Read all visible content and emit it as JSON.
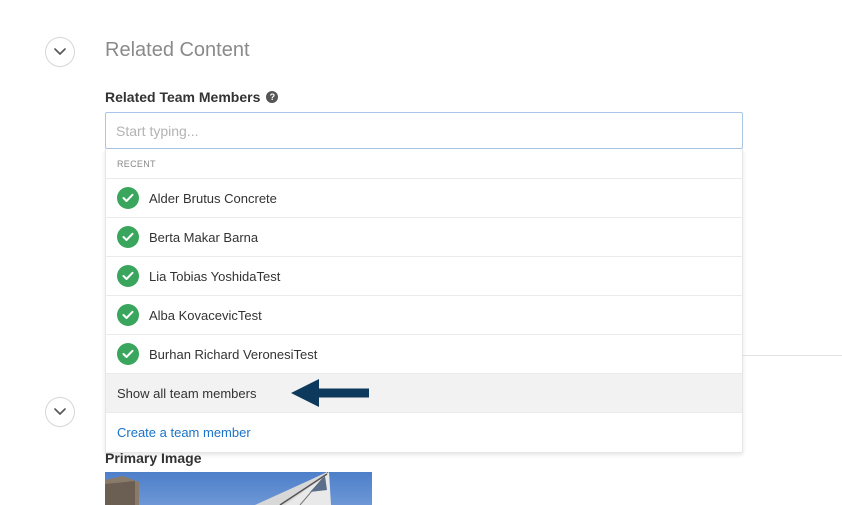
{
  "section": {
    "title": "Related Content"
  },
  "team_members": {
    "label": "Related Team Members",
    "help_icon": "question-circle-icon",
    "search_placeholder": "Start typing...",
    "dropdown": {
      "header": "RECENT",
      "items": [
        {
          "name": "Alder Brutus Concrete",
          "icon": "check-circle-icon"
        },
        {
          "name": "Berta Makar Barna",
          "icon": "check-circle-icon"
        },
        {
          "name": "Lia Tobias YoshidaTest",
          "icon": "check-circle-icon"
        },
        {
          "name": "Alba KovacevicTest",
          "icon": "check-circle-icon"
        },
        {
          "name": "Burhan Richard VeronesiTest",
          "icon": "check-circle-icon"
        }
      ],
      "show_all_label": "Show all team members",
      "create_label": "Create a team member"
    }
  },
  "primary_image": {
    "label": "Primary Image"
  },
  "colors": {
    "check_green": "#3aa55d",
    "link_blue": "#1a73c8",
    "annotation_arrow": "#0d3a5c"
  }
}
